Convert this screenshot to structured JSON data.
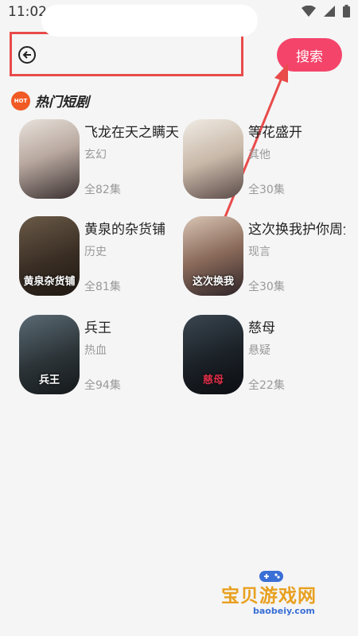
{
  "status_bar": {
    "time": "11:02"
  },
  "search": {
    "placeholder": "",
    "button_label": "搜索"
  },
  "section": {
    "badge": "HOT",
    "title": "热门短剧"
  },
  "dramas": [
    {
      "title": "飞龙在天之瞒天",
      "genre": "玄幻",
      "episodes": "全82集",
      "cover_text": ""
    },
    {
      "title": "等花盛开",
      "genre": "其他",
      "episodes": "全30集",
      "cover_text": ""
    },
    {
      "title": "黄泉的杂货铺",
      "genre": "历史",
      "episodes": "全81集",
      "cover_text": "黄泉杂货铺"
    },
    {
      "title": "这次换我护你周全",
      "genre": "现言",
      "episodes": "全30集",
      "cover_text": "这次换我"
    },
    {
      "title": "兵王",
      "genre": "热血",
      "episodes": "全94集",
      "cover_text": "兵王"
    },
    {
      "title": "慈母",
      "genre": "悬疑",
      "episodes": "全22集",
      "cover_text": "慈母"
    }
  ],
  "watermark": {
    "text": "宝贝游戏网",
    "url": "baobeiy.com"
  },
  "colors": {
    "accent": "#f4446a",
    "highlight_border": "#e94a4a",
    "muted_text": "#999999"
  }
}
